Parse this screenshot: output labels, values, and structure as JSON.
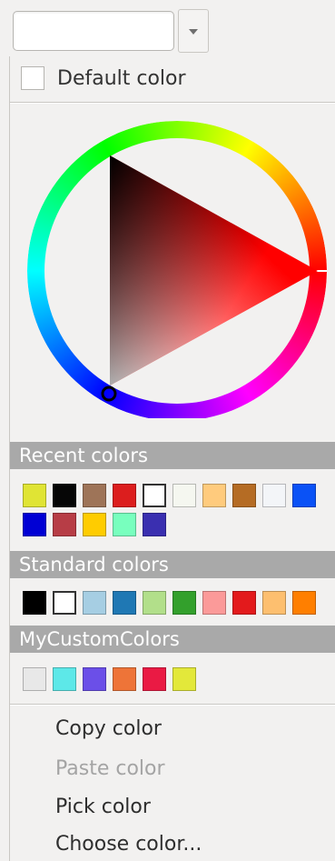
{
  "default_color": {
    "label": "Default color",
    "checked": false
  },
  "sections": {
    "recent": {
      "title": "Recent colors",
      "colors": [
        "#e0e434",
        "#060606",
        "#9e7458",
        "#dc1e1e",
        "#ffffff",
        "#f5f7f0",
        "#ffcb7d",
        "#b56c24",
        "#f3f5f8",
        "#0a52f6",
        "#0000d4",
        "#b73d46",
        "#ffcc00",
        "#78ffbe",
        "#3a2fb0"
      ]
    },
    "standard": {
      "title": "Standard colors",
      "colors": [
        "#000000",
        "#ffffff",
        "#a6cee3",
        "#1f78b4",
        "#b2df8a",
        "#33a02c",
        "#fb9a99",
        "#e31a1c",
        "#fdbf6f",
        "#ff7f00"
      ]
    },
    "custom": {
      "title": "MyCustomColors",
      "colors": [
        "#e8e8e8",
        "#5de8e8",
        "#6b4fe8",
        "#ee7438",
        "#ea1a44",
        "#e3e83a"
      ]
    }
  },
  "menu": {
    "copy": "Copy color",
    "paste": "Paste color",
    "pick": "Pick color",
    "choose": "Choose color..."
  },
  "wheel": {
    "hue_color": "#ff0000"
  }
}
